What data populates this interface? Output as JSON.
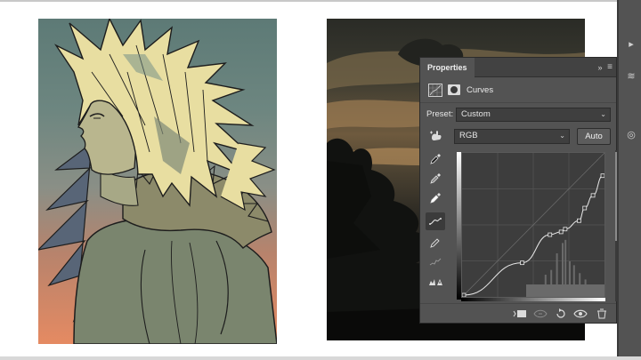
{
  "panel": {
    "tab": "Properties",
    "collapse_icon": "double-chevron-right-icon",
    "menu_icon": "panel-menu-icon",
    "title": "Curves",
    "preset_label": "Preset:",
    "preset_value": "Custom",
    "channel_value": "RGB",
    "auto_label": "Auto"
  },
  "curve": {
    "points": [
      [
        0,
        0
      ],
      [
        0.42,
        0.23
      ],
      [
        0.62,
        0.43
      ],
      [
        0.7,
        0.45
      ],
      [
        0.73,
        0.47
      ],
      [
        0.83,
        0.53
      ],
      [
        0.87,
        0.62
      ],
      [
        0.93,
        0.71
      ],
      [
        1.0,
        0.85
      ]
    ]
  },
  "tools": [
    "eyedropper-black-icon",
    "eyedropper-gray-icon",
    "eyedropper-white-icon",
    "curve-edit-points-icon",
    "pencil-draw-icon",
    "smooth-curve-icon",
    "clipping-warning-icon"
  ],
  "footer": [
    "clip-to-layer-icon",
    "view-previous-state-icon",
    "reset-icon",
    "visibility-eye-icon",
    "trash-icon"
  ],
  "colors": {
    "panel_bg": "#535353",
    "panel_dark": "#424242",
    "curve_bg": "#3d3d3d"
  }
}
